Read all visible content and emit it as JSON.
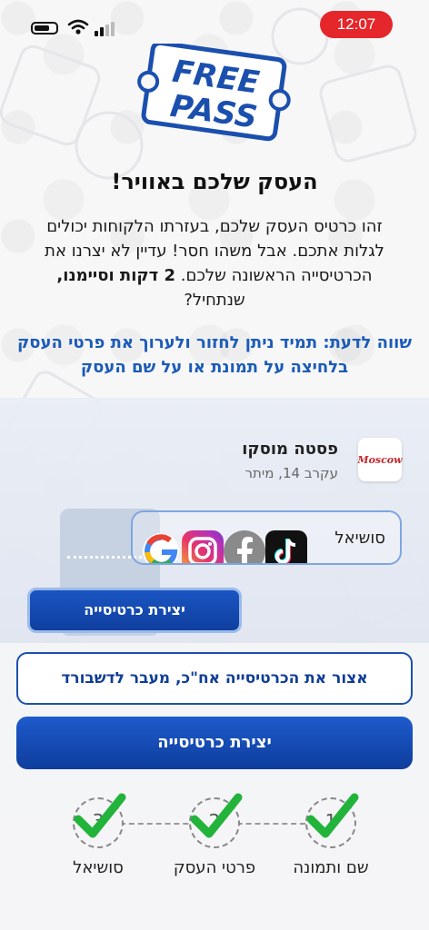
{
  "status_bar": {
    "time": "12:07"
  },
  "logo": {
    "line1": "FREE",
    "line2": "PASS"
  },
  "headline": "העסק שלכם באוויר!",
  "intro": {
    "part1": "זהו כרטיס העסק שלכם, בעזרתו הלקוחות יכולים לגלות אתכם. אבל משהו חסר! עדיין לא יצרנו את הכרטיסייה הראשונה שלכם.",
    "bold": "2 דקות וסיימנו,",
    "part2": "שנתחיל?"
  },
  "note": "שווה לדעת: תמיד ניתן לחזור ולערוך את פרטי העסק בלחיצה על תמונת או על שם העסק",
  "business": {
    "logo_text": "Moscow",
    "name": "פסטה מוסקו",
    "address": "עקרב 14, מיתר"
  },
  "social": {
    "label": "סושיאל",
    "icons": [
      "google-icon",
      "instagram-icon",
      "facebook-icon",
      "tiktok-icon"
    ]
  },
  "preview_button": "יצירת כרטיסייה",
  "buttons": {
    "dashboard": "אצור את הכרטיסייה אח\"כ, מעבר לדשבורד",
    "create": "יצירת כרטיסייה"
  },
  "steps": [
    {
      "number": "1",
      "label": "שם ותמונה",
      "done": true
    },
    {
      "number": "2",
      "label": "פרטי העסק",
      "done": true
    },
    {
      "number": "3",
      "label": "סושיאל",
      "done": true
    }
  ],
  "colors": {
    "brand_blue": "#1b4fae",
    "accent_red": "#e5262b",
    "check_green": "#22b33a",
    "note_blue": "#1b5bb8"
  }
}
